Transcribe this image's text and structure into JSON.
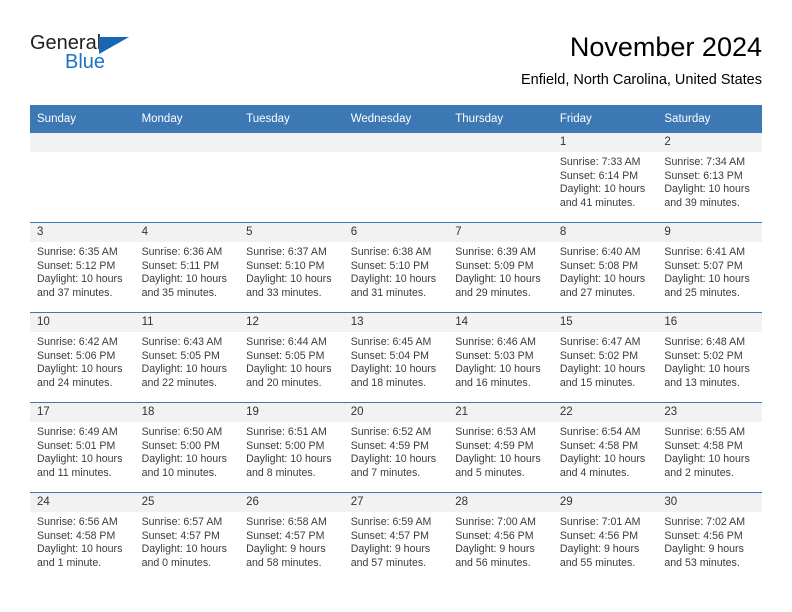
{
  "logo": {
    "word_one": "General",
    "word_two": "Blue",
    "triangle_color": "#1a66b3",
    "blue_text_color": "#1a73c4"
  },
  "header": {
    "title": "November 2024",
    "subtitle": "Enfield, North Carolina, United States"
  },
  "theme": {
    "header_bar_color": "#3b78b4",
    "daynum_band_color": "#f2f2f2",
    "row_divider_color": "#3b78b4",
    "text_color": "#3b3b3b"
  },
  "weekdays": [
    "Sunday",
    "Monday",
    "Tuesday",
    "Wednesday",
    "Thursday",
    "Friday",
    "Saturday"
  ],
  "weeks": [
    [
      {
        "day": "",
        "sunrise": "",
        "sunset": "",
        "daylight": ""
      },
      {
        "day": "",
        "sunrise": "",
        "sunset": "",
        "daylight": ""
      },
      {
        "day": "",
        "sunrise": "",
        "sunset": "",
        "daylight": ""
      },
      {
        "day": "",
        "sunrise": "",
        "sunset": "",
        "daylight": ""
      },
      {
        "day": "",
        "sunrise": "",
        "sunset": "",
        "daylight": ""
      },
      {
        "day": "1",
        "sunrise": "Sunrise: 7:33 AM",
        "sunset": "Sunset: 6:14 PM",
        "daylight": "Daylight: 10 hours and 41 minutes."
      },
      {
        "day": "2",
        "sunrise": "Sunrise: 7:34 AM",
        "sunset": "Sunset: 6:13 PM",
        "daylight": "Daylight: 10 hours and 39 minutes."
      }
    ],
    [
      {
        "day": "3",
        "sunrise": "Sunrise: 6:35 AM",
        "sunset": "Sunset: 5:12 PM",
        "daylight": "Daylight: 10 hours and 37 minutes."
      },
      {
        "day": "4",
        "sunrise": "Sunrise: 6:36 AM",
        "sunset": "Sunset: 5:11 PM",
        "daylight": "Daylight: 10 hours and 35 minutes."
      },
      {
        "day": "5",
        "sunrise": "Sunrise: 6:37 AM",
        "sunset": "Sunset: 5:10 PM",
        "daylight": "Daylight: 10 hours and 33 minutes."
      },
      {
        "day": "6",
        "sunrise": "Sunrise: 6:38 AM",
        "sunset": "Sunset: 5:10 PM",
        "daylight": "Daylight: 10 hours and 31 minutes."
      },
      {
        "day": "7",
        "sunrise": "Sunrise: 6:39 AM",
        "sunset": "Sunset: 5:09 PM",
        "daylight": "Daylight: 10 hours and 29 minutes."
      },
      {
        "day": "8",
        "sunrise": "Sunrise: 6:40 AM",
        "sunset": "Sunset: 5:08 PM",
        "daylight": "Daylight: 10 hours and 27 minutes."
      },
      {
        "day": "9",
        "sunrise": "Sunrise: 6:41 AM",
        "sunset": "Sunset: 5:07 PM",
        "daylight": "Daylight: 10 hours and 25 minutes."
      }
    ],
    [
      {
        "day": "10",
        "sunrise": "Sunrise: 6:42 AM",
        "sunset": "Sunset: 5:06 PM",
        "daylight": "Daylight: 10 hours and 24 minutes."
      },
      {
        "day": "11",
        "sunrise": "Sunrise: 6:43 AM",
        "sunset": "Sunset: 5:05 PM",
        "daylight": "Daylight: 10 hours and 22 minutes."
      },
      {
        "day": "12",
        "sunrise": "Sunrise: 6:44 AM",
        "sunset": "Sunset: 5:05 PM",
        "daylight": "Daylight: 10 hours and 20 minutes."
      },
      {
        "day": "13",
        "sunrise": "Sunrise: 6:45 AM",
        "sunset": "Sunset: 5:04 PM",
        "daylight": "Daylight: 10 hours and 18 minutes."
      },
      {
        "day": "14",
        "sunrise": "Sunrise: 6:46 AM",
        "sunset": "Sunset: 5:03 PM",
        "daylight": "Daylight: 10 hours and 16 minutes."
      },
      {
        "day": "15",
        "sunrise": "Sunrise: 6:47 AM",
        "sunset": "Sunset: 5:02 PM",
        "daylight": "Daylight: 10 hours and 15 minutes."
      },
      {
        "day": "16",
        "sunrise": "Sunrise: 6:48 AM",
        "sunset": "Sunset: 5:02 PM",
        "daylight": "Daylight: 10 hours and 13 minutes."
      }
    ],
    [
      {
        "day": "17",
        "sunrise": "Sunrise: 6:49 AM",
        "sunset": "Sunset: 5:01 PM",
        "daylight": "Daylight: 10 hours and 11 minutes."
      },
      {
        "day": "18",
        "sunrise": "Sunrise: 6:50 AM",
        "sunset": "Sunset: 5:00 PM",
        "daylight": "Daylight: 10 hours and 10 minutes."
      },
      {
        "day": "19",
        "sunrise": "Sunrise: 6:51 AM",
        "sunset": "Sunset: 5:00 PM",
        "daylight": "Daylight: 10 hours and 8 minutes."
      },
      {
        "day": "20",
        "sunrise": "Sunrise: 6:52 AM",
        "sunset": "Sunset: 4:59 PM",
        "daylight": "Daylight: 10 hours and 7 minutes."
      },
      {
        "day": "21",
        "sunrise": "Sunrise: 6:53 AM",
        "sunset": "Sunset: 4:59 PM",
        "daylight": "Daylight: 10 hours and 5 minutes."
      },
      {
        "day": "22",
        "sunrise": "Sunrise: 6:54 AM",
        "sunset": "Sunset: 4:58 PM",
        "daylight": "Daylight: 10 hours and 4 minutes."
      },
      {
        "day": "23",
        "sunrise": "Sunrise: 6:55 AM",
        "sunset": "Sunset: 4:58 PM",
        "daylight": "Daylight: 10 hours and 2 minutes."
      }
    ],
    [
      {
        "day": "24",
        "sunrise": "Sunrise: 6:56 AM",
        "sunset": "Sunset: 4:58 PM",
        "daylight": "Daylight: 10 hours and 1 minute."
      },
      {
        "day": "25",
        "sunrise": "Sunrise: 6:57 AM",
        "sunset": "Sunset: 4:57 PM",
        "daylight": "Daylight: 10 hours and 0 minutes."
      },
      {
        "day": "26",
        "sunrise": "Sunrise: 6:58 AM",
        "sunset": "Sunset: 4:57 PM",
        "daylight": "Daylight: 9 hours and 58 minutes."
      },
      {
        "day": "27",
        "sunrise": "Sunrise: 6:59 AM",
        "sunset": "Sunset: 4:57 PM",
        "daylight": "Daylight: 9 hours and 57 minutes."
      },
      {
        "day": "28",
        "sunrise": "Sunrise: 7:00 AM",
        "sunset": "Sunset: 4:56 PM",
        "daylight": "Daylight: 9 hours and 56 minutes."
      },
      {
        "day": "29",
        "sunrise": "Sunrise: 7:01 AM",
        "sunset": "Sunset: 4:56 PM",
        "daylight": "Daylight: 9 hours and 55 minutes."
      },
      {
        "day": "30",
        "sunrise": "Sunrise: 7:02 AM",
        "sunset": "Sunset: 4:56 PM",
        "daylight": "Daylight: 9 hours and 53 minutes."
      }
    ]
  ]
}
